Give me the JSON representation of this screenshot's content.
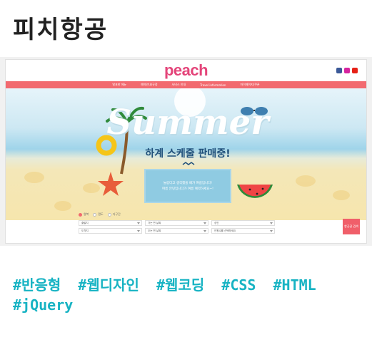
{
  "page_title": "피치항공",
  "site": {
    "logo": "peach",
    "nav": [
      "발표한 메뉴",
      "예약안내/규정",
      "서비스 안내",
      "Travel information",
      "마이페이지/쿠폰"
    ],
    "hero": {
      "headline": "Summer",
      "subtitle": "하계 스케줄 판매중!",
      "card_line1": "놀랍다고 생각했을 때가 여름입니다!",
      "card_line2": "여름 안녕입니다가 여름 예약하세요~!"
    },
    "search": {
      "radios": [
        {
          "label": "왕복",
          "selected": true
        },
        {
          "label": "편도",
          "selected": false
        },
        {
          "label": "다구간",
          "selected": false
        }
      ],
      "row1": [
        "출발지",
        "가는 편 날짜",
        "성인"
      ],
      "row2": [
        "도착지",
        "오는 편 날짜",
        "인원수를 선택하세요"
      ],
      "button": "항공권 검색"
    },
    "colors": {
      "brand": "#e4457a",
      "nav": "#f26a6f",
      "button": "#f05f6a"
    }
  },
  "tags": [
    "#반응형",
    "#웹디자인",
    "#웹코딩",
    "#CSS",
    "#HTML",
    "#jQuery"
  ]
}
